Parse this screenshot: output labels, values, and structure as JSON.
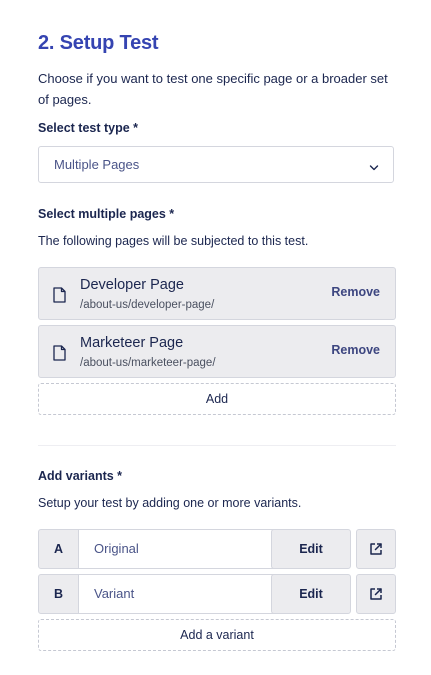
{
  "section": {
    "title": "2. Setup Test",
    "intro": "Choose if you want to test one specific page or a broader set of pages."
  },
  "test_type": {
    "label": "Select test type *",
    "value": "Multiple Pages",
    "icon": "chevron-down-icon"
  },
  "pages": {
    "label": "Select multiple pages *",
    "helper": "The following pages will be subjected to this test.",
    "items": [
      {
        "title": "Developer Page",
        "url": "/about-us/developer-page/",
        "remove_label": "Remove",
        "icon": "document-icon"
      },
      {
        "title": "Marketeer Page",
        "url": "/about-us/marketeer-page/",
        "remove_label": "Remove",
        "icon": "document-icon"
      }
    ],
    "add_label": "Add"
  },
  "variants": {
    "label": "Add variants *",
    "helper": "Setup your test by adding one or more variants.",
    "items": [
      {
        "letter": "A",
        "name": "Original",
        "edit_label": "Edit",
        "icon": "external-link-icon"
      },
      {
        "letter": "B",
        "name": "Variant",
        "edit_label": "Edit",
        "icon": "external-link-icon"
      }
    ],
    "add_label": "Add a variant"
  },
  "colors": {
    "heading": "#3544b1",
    "text": "#1b264f",
    "card_bg": "#ececef",
    "border": "#d4d6de"
  }
}
